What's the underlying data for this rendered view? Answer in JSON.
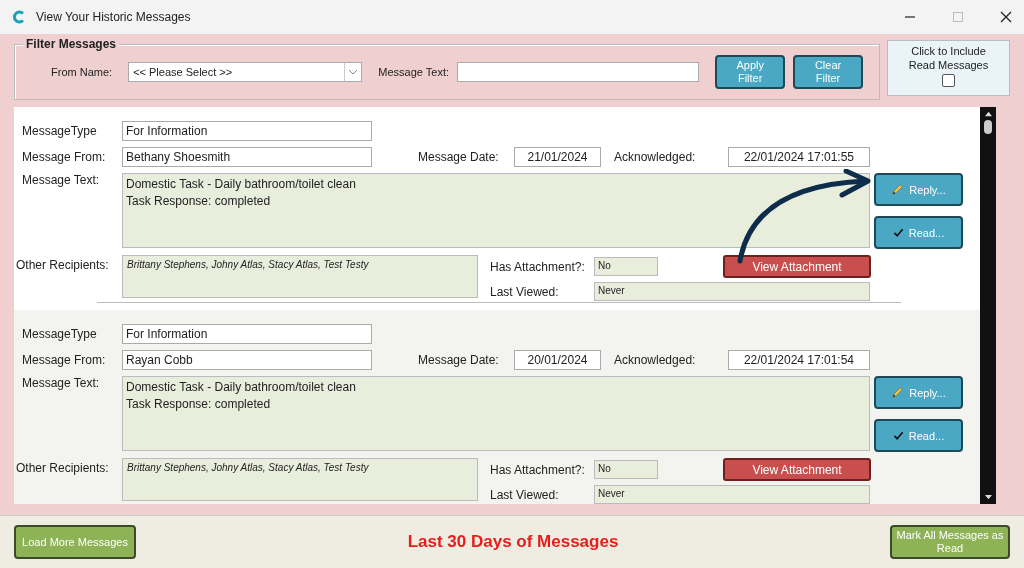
{
  "window": {
    "title": "View Your Historic Messages"
  },
  "filter": {
    "title": "Filter Messages",
    "from_label": "From Name:",
    "from_value": "<< Please Select >>",
    "text_label": "Message Text:",
    "apply": "Apply Filter",
    "clear": "Clear Filter"
  },
  "include_read": {
    "label": "Click to Include Read Messages",
    "checked": false
  },
  "messages": [
    {
      "selected": true,
      "type_label": "MessageType",
      "type": "For Information",
      "from_label": "Message From:",
      "from": "Bethany Shoesmith",
      "date_label": "Message Date:",
      "date": "21/01/2024",
      "ack_label": "Acknowledged:",
      "ack": "22/01/2024 17:01:55",
      "text_label": "Message Text:",
      "text": [
        "Domestic Task - Daily bathroom/toilet clean",
        "Task Response: completed"
      ],
      "reply": "Reply...",
      "read": "Read...",
      "recipients_label": "Other Recipients:",
      "recipients": "Brittany Stephens, Johny Atlas, Stacy Atlas, Test Testy",
      "attach_label": "Has Attachment?:",
      "attach": "No",
      "view": "View Attachment",
      "viewed_label": "Last Viewed:",
      "viewed": "Never"
    },
    {
      "selected": false,
      "type_label": "MessageType",
      "type": "For Information",
      "from_label": "Message From:",
      "from": "Rayan Cobb",
      "date_label": "Message Date:",
      "date": "20/01/2024",
      "ack_label": "Acknowledged:",
      "ack": "22/01/2024 17:01:54",
      "text_label": "Message Text:",
      "text": [
        "Domestic Task - Daily bathroom/toilet clean",
        "Task Response: completed"
      ],
      "reply": "Reply...",
      "read": "Read...",
      "recipients_label": "Other Recipients:",
      "recipients": "Brittany Stephens, Johny Atlas, Stacy Atlas, Test Testy",
      "attach_label": "Has Attachment?:",
      "attach": "No",
      "view": "View Attachment",
      "viewed_label": "Last Viewed:",
      "viewed": "Never"
    }
  ],
  "footer": {
    "load_more": "Load More Messages",
    "caption": "Last 30 Days of Messages",
    "mark_all": "Mark All Messages as Read"
  }
}
